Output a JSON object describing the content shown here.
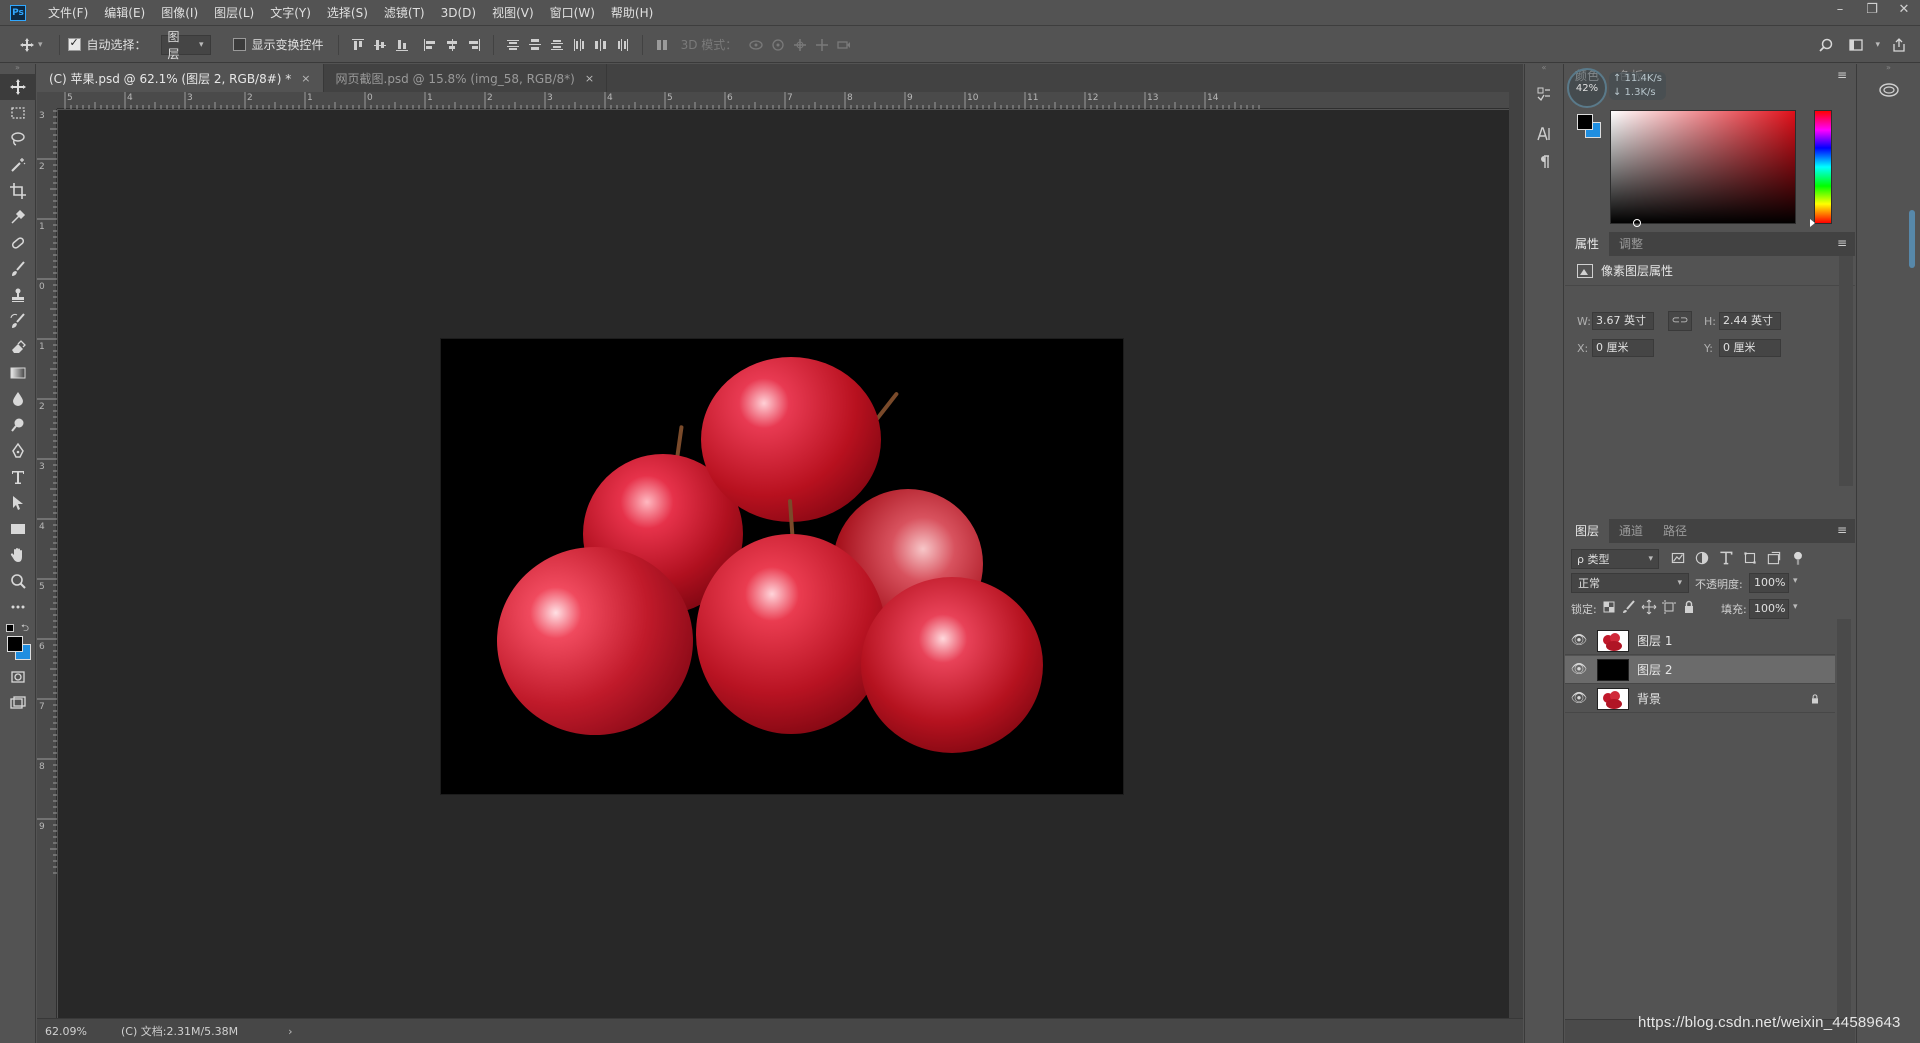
{
  "app": {
    "logo": "Ps"
  },
  "menu": [
    "文件(F)",
    "编辑(E)",
    "图像(I)",
    "图层(L)",
    "文字(Y)",
    "选择(S)",
    "滤镜(T)",
    "3D(D)",
    "视图(V)",
    "窗口(W)",
    "帮助(H)"
  ],
  "window_controls": {
    "minimize": "–",
    "restore": "❐",
    "close": "✕"
  },
  "options": {
    "auto_select_label": "自动选择：",
    "auto_select_value": "图层",
    "show_transform_label": "显示变换控件",
    "mode_3d_label": "3D 模式："
  },
  "tabs": [
    {
      "label": "(C) 苹果.psd @ 62.1% (图层 2, RGB/8#) *"
    },
    {
      "label": "网页截图.psd @ 15.8% (img_58, RGB/8*)"
    }
  ],
  "tab_close": "×",
  "ruler": {
    "top": [
      "5",
      "4",
      "3",
      "2",
      "1",
      "0",
      "1",
      "2",
      "3",
      "4",
      "5",
      "6",
      "7",
      "8",
      "9",
      "10",
      "11",
      "12",
      "13",
      "14"
    ],
    "left": [
      "3",
      "2",
      "1",
      "0",
      "1",
      "2",
      "3",
      "4",
      "5",
      "6",
      "7",
      "8",
      "9"
    ]
  },
  "status": {
    "zoom": "62.09%",
    "doc": "(C) 文档:2.31M/5.38M",
    "arrow": "›"
  },
  "color_panel": {
    "tab1": "颜色",
    "tab2": "色板",
    "net_up": "↑ 11.4K/s",
    "net_down": "↓ 1.3K/s",
    "pct": "42%"
  },
  "properties": {
    "tab_props": "属性",
    "tab_adjust": "调整",
    "title": "像素图层属性",
    "w_label": "W:",
    "w_value": "3.67 英寸",
    "h_label": "H:",
    "h_value": "2.44 英寸",
    "x_label": "X:",
    "x_value": "0 厘米",
    "y_label": "Y:",
    "y_value": "0 厘米"
  },
  "layers_panel": {
    "tab_layers": "图层",
    "tab_channels": "通道",
    "tab_paths": "路径",
    "filter_label": "ρ 类型",
    "blend_mode": "正常",
    "opacity_label": "不透明度:",
    "opacity_value": "100%",
    "lock_label": "锁定:",
    "fill_label": "填充:",
    "fill_value": "100%",
    "layers": [
      {
        "name": "图层 1",
        "thumb": "apples",
        "selected": false,
        "locked": false
      },
      {
        "name": "图层 2",
        "thumb": "black",
        "selected": true,
        "locked": false
      },
      {
        "name": "背景",
        "thumb": "apples",
        "selected": false,
        "locked": true
      }
    ]
  },
  "watermark": "https://blog.csdn.net/weixin_44589643",
  "colors": {
    "panel": "#535353",
    "canvas_bg": "#282828",
    "accent": "#31a8ff",
    "fg_swatch": "#000000",
    "bg_swatch": "#1f8ee0"
  }
}
